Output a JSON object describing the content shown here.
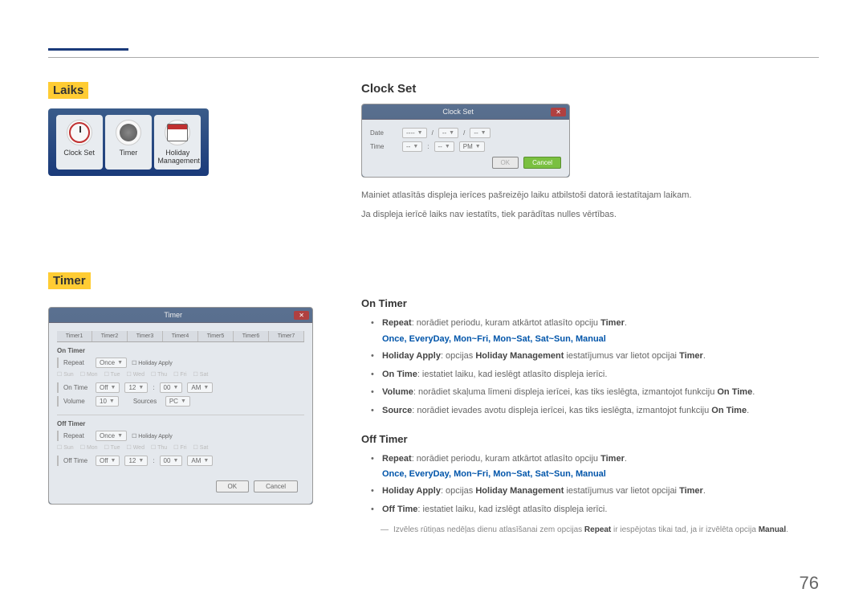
{
  "page": "76",
  "left": {
    "laiks_heading": "Laiks",
    "timer_heading": "Timer",
    "close": "✕",
    "tray": [
      "Clock Set",
      "Timer",
      "Holiday Management"
    ],
    "days": [
      "Sun",
      "Mon",
      "Tue",
      "Wed",
      "Thu",
      "Fri",
      "Sat"
    ],
    "timer_dialog": {
      "title": "Timer",
      "tabs": [
        "Timer1",
        "Timer2",
        "Timer3",
        "Timer4",
        "Timer5",
        "Timer6",
        "Timer7"
      ],
      "on_timer": "On Timer",
      "off_timer": "Off Timer",
      "repeat": "Repeat",
      "once": "Once",
      "holiday_apply": "Holiday Apply",
      "on_time": "On Time",
      "off_time": "Off Time",
      "off": "Off",
      "h12": "12",
      "m00": "00",
      "am": "AM",
      "volume": "Volume",
      "vol": "10",
      "sources": "Sources",
      "pc": "PC",
      "ok": "OK",
      "cancel": "Cancel"
    }
  },
  "right": {
    "clock_set": {
      "heading": "Clock Set",
      "dialog_title": "Clock Set",
      "date": "Date",
      "time": "Time",
      "dashes4": "----",
      "dashes2": "--",
      "pm": "PM",
      "ok": "OK",
      "cancel": "Cancel",
      "text1": "Mainiet atlasītās displeja ierīces pašreizējo laiku atbilstoši datorā iestatītajam laikam.",
      "text2": "Ja displeja ierīcē laiks nav iestatīts, tiek parādītas nulles vērtības."
    },
    "shared": {
      "timer": "Timer",
      "holiday_mgmt": "Holiday Management",
      "on_time_fn": "On Time",
      "options": "Once, EveryDay, Mon~Fri, Mon~Sat, Sat~Sun, Manual"
    },
    "on_timer": {
      "heading": "On Timer",
      "b_repeat": "Repeat",
      "repeat_text": ": norādiet periodu, kuram atkārtot atlasīto opciju ",
      "b_holiday": "Holiday Apply",
      "holiday_pre": ": opcijas ",
      "holiday_post": " iestatījumus var lietot opcijai ",
      "b_ontime": "On Time",
      "ontime_text": ": iestatiet laiku, kad ieslēgt atlasīto displeja ierīci.",
      "b_volume": "Volume",
      "volume_text": ": norādiet skaļuma līmeni displeja ierīcei, kas tiks ieslēgta, izmantojot funkciju ",
      "b_source": "Source",
      "source_text": ": norādiet ievades avotu displeja ierīcei, kas tiks ieslēgta, izmantojot funkciju "
    },
    "off_timer": {
      "heading": "Off Timer",
      "b_offtime": "Off Time",
      "offtime_text": ": iestatiet laiku, kad izslēgt atlasīto displeja ierīci."
    },
    "note": {
      "pre": "Izvēles rūtiņas nedēļas dienu atlasīšanai zem opcijas ",
      "repeat": "Repeat",
      "mid": " ir iespējotas tikai tad, ja ir izvēlēta opcija ",
      "manual": "Manual"
    }
  }
}
